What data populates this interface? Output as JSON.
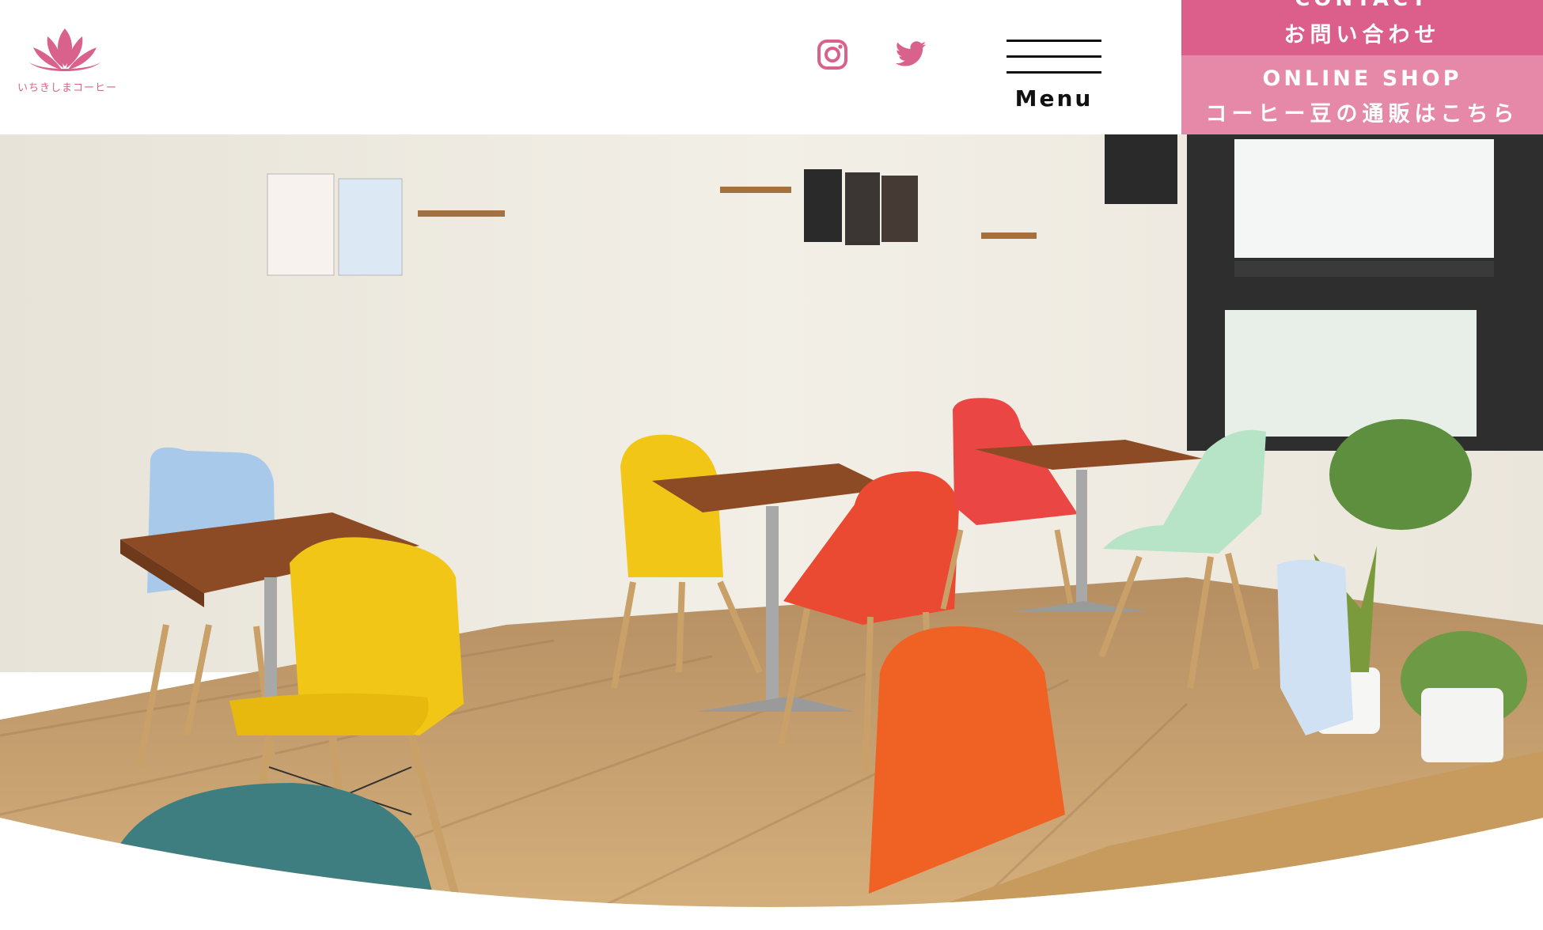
{
  "brand": {
    "name": "いちきしまコーヒー",
    "logo_icon": "lotus-icon",
    "colors": {
      "accent": "#dc5e8a",
      "accent_light": "#e689a8"
    }
  },
  "social": {
    "instagram": {
      "icon": "instagram-icon"
    },
    "twitter": {
      "icon": "twitter-icon"
    }
  },
  "nav": {
    "menu_label": "Menu",
    "menu_icon": "hamburger-icon"
  },
  "contact": {
    "label_en": "CONTACT",
    "label_ja": "お問い合わせ"
  },
  "online_shop": {
    "label_en": "ONLINE SHOP",
    "label_ja": "コーヒー豆の通販はこちら"
  }
}
